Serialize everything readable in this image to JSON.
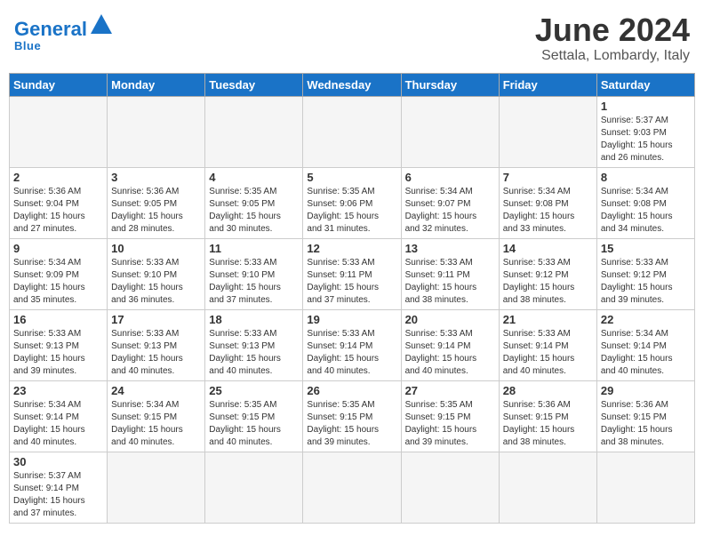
{
  "header": {
    "logo_general": "General",
    "logo_blue": "Blue",
    "title": "June 2024",
    "subtitle": "Settala, Lombardy, Italy"
  },
  "days_of_week": [
    "Sunday",
    "Monday",
    "Tuesday",
    "Wednesday",
    "Thursday",
    "Friday",
    "Saturday"
  ],
  "weeks": [
    [
      {
        "day": "",
        "info": ""
      },
      {
        "day": "",
        "info": ""
      },
      {
        "day": "",
        "info": ""
      },
      {
        "day": "",
        "info": ""
      },
      {
        "day": "",
        "info": ""
      },
      {
        "day": "",
        "info": ""
      },
      {
        "day": "1",
        "info": "Sunrise: 5:37 AM\nSunset: 9:03 PM\nDaylight: 15 hours\nand 26 minutes."
      }
    ],
    [
      {
        "day": "2",
        "info": "Sunrise: 5:36 AM\nSunset: 9:04 PM\nDaylight: 15 hours\nand 27 minutes."
      },
      {
        "day": "3",
        "info": "Sunrise: 5:36 AM\nSunset: 9:05 PM\nDaylight: 15 hours\nand 28 minutes."
      },
      {
        "day": "4",
        "info": "Sunrise: 5:35 AM\nSunset: 9:05 PM\nDaylight: 15 hours\nand 30 minutes."
      },
      {
        "day": "5",
        "info": "Sunrise: 5:35 AM\nSunset: 9:06 PM\nDaylight: 15 hours\nand 31 minutes."
      },
      {
        "day": "6",
        "info": "Sunrise: 5:34 AM\nSunset: 9:07 PM\nDaylight: 15 hours\nand 32 minutes."
      },
      {
        "day": "7",
        "info": "Sunrise: 5:34 AM\nSunset: 9:08 PM\nDaylight: 15 hours\nand 33 minutes."
      },
      {
        "day": "8",
        "info": "Sunrise: 5:34 AM\nSunset: 9:08 PM\nDaylight: 15 hours\nand 34 minutes."
      }
    ],
    [
      {
        "day": "9",
        "info": "Sunrise: 5:34 AM\nSunset: 9:09 PM\nDaylight: 15 hours\nand 35 minutes."
      },
      {
        "day": "10",
        "info": "Sunrise: 5:33 AM\nSunset: 9:10 PM\nDaylight: 15 hours\nand 36 minutes."
      },
      {
        "day": "11",
        "info": "Sunrise: 5:33 AM\nSunset: 9:10 PM\nDaylight: 15 hours\nand 37 minutes."
      },
      {
        "day": "12",
        "info": "Sunrise: 5:33 AM\nSunset: 9:11 PM\nDaylight: 15 hours\nand 37 minutes."
      },
      {
        "day": "13",
        "info": "Sunrise: 5:33 AM\nSunset: 9:11 PM\nDaylight: 15 hours\nand 38 minutes."
      },
      {
        "day": "14",
        "info": "Sunrise: 5:33 AM\nSunset: 9:12 PM\nDaylight: 15 hours\nand 38 minutes."
      },
      {
        "day": "15",
        "info": "Sunrise: 5:33 AM\nSunset: 9:12 PM\nDaylight: 15 hours\nand 39 minutes."
      }
    ],
    [
      {
        "day": "16",
        "info": "Sunrise: 5:33 AM\nSunset: 9:13 PM\nDaylight: 15 hours\nand 39 minutes."
      },
      {
        "day": "17",
        "info": "Sunrise: 5:33 AM\nSunset: 9:13 PM\nDaylight: 15 hours\nand 40 minutes."
      },
      {
        "day": "18",
        "info": "Sunrise: 5:33 AM\nSunset: 9:13 PM\nDaylight: 15 hours\nand 40 minutes."
      },
      {
        "day": "19",
        "info": "Sunrise: 5:33 AM\nSunset: 9:14 PM\nDaylight: 15 hours\nand 40 minutes."
      },
      {
        "day": "20",
        "info": "Sunrise: 5:33 AM\nSunset: 9:14 PM\nDaylight: 15 hours\nand 40 minutes."
      },
      {
        "day": "21",
        "info": "Sunrise: 5:33 AM\nSunset: 9:14 PM\nDaylight: 15 hours\nand 40 minutes."
      },
      {
        "day": "22",
        "info": "Sunrise: 5:34 AM\nSunset: 9:14 PM\nDaylight: 15 hours\nand 40 minutes."
      }
    ],
    [
      {
        "day": "23",
        "info": "Sunrise: 5:34 AM\nSunset: 9:14 PM\nDaylight: 15 hours\nand 40 minutes."
      },
      {
        "day": "24",
        "info": "Sunrise: 5:34 AM\nSunset: 9:15 PM\nDaylight: 15 hours\nand 40 minutes."
      },
      {
        "day": "25",
        "info": "Sunrise: 5:35 AM\nSunset: 9:15 PM\nDaylight: 15 hours\nand 40 minutes."
      },
      {
        "day": "26",
        "info": "Sunrise: 5:35 AM\nSunset: 9:15 PM\nDaylight: 15 hours\nand 39 minutes."
      },
      {
        "day": "27",
        "info": "Sunrise: 5:35 AM\nSunset: 9:15 PM\nDaylight: 15 hours\nand 39 minutes."
      },
      {
        "day": "28",
        "info": "Sunrise: 5:36 AM\nSunset: 9:15 PM\nDaylight: 15 hours\nand 38 minutes."
      },
      {
        "day": "29",
        "info": "Sunrise: 5:36 AM\nSunset: 9:15 PM\nDaylight: 15 hours\nand 38 minutes."
      }
    ],
    [
      {
        "day": "30",
        "info": "Sunrise: 5:37 AM\nSunset: 9:14 PM\nDaylight: 15 hours\nand 37 minutes."
      },
      {
        "day": "",
        "info": ""
      },
      {
        "day": "",
        "info": ""
      },
      {
        "day": "",
        "info": ""
      },
      {
        "day": "",
        "info": ""
      },
      {
        "day": "",
        "info": ""
      },
      {
        "day": "",
        "info": ""
      }
    ]
  ]
}
